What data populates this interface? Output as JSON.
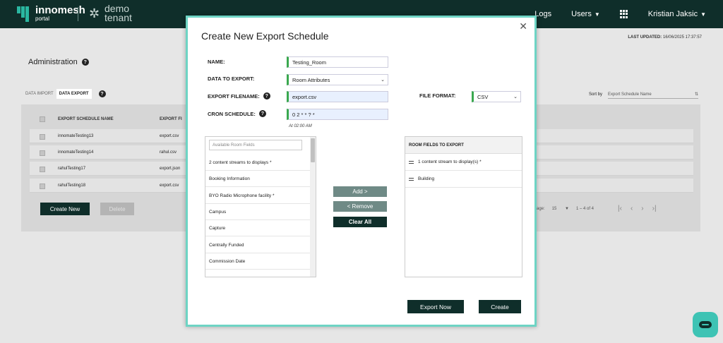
{
  "brand": {
    "name": "innomesh",
    "sub": "portal",
    "tenant_line1": "demo",
    "tenant_line2": "tenant"
  },
  "nav": {
    "items": [
      {
        "label": "Logs",
        "has_caret": false
      },
      {
        "label": "Users",
        "has_caret": true
      }
    ],
    "user": "Kristian Jaksic"
  },
  "background": {
    "last_updated_label": "LAST UPDATED:",
    "last_updated_value": "16/06/2025 17:37:57",
    "page_title": "Administration",
    "tabs": [
      "DATA IMPORT",
      "DATA EXPORT"
    ],
    "active_tab": "DATA EXPORT",
    "sort_by_label": "Sort by",
    "sort_by_value": "Export Schedule Name",
    "table_headers": [
      "EXPORT SCHEDULE NAME",
      "EXPORT FI"
    ],
    "rows": [
      {
        "name": "innomateTesting13",
        "file": "export.csv"
      },
      {
        "name": "innomateTesting14",
        "file": "rahul.csv"
      },
      {
        "name": "rahulTesting17",
        "file": "export.json"
      },
      {
        "name": "rahulTesting18",
        "file": "export.csv"
      }
    ],
    "create_label": "Create New",
    "delete_label": "Delete",
    "per_page_label": "age:",
    "per_page_value": "15",
    "range": "1 – 4 of 4"
  },
  "modal": {
    "title": "Create New Export Schedule",
    "name_label": "NAME:",
    "name_value": "Testing_Room",
    "data_label": "DATA TO EXPORT:",
    "data_value": "Room Attributes",
    "filename_label": "EXPORT FILENAME:",
    "filename_value": "export.csv",
    "format_label": "FILE FORMAT:",
    "format_value": "CSV",
    "cron_label": "CRON SCHEDULE:",
    "cron_value": "0 2 * * ? *",
    "cron_hint": "At 02:00 AM",
    "available_placeholder": "Available Room Fields",
    "available_fields": [
      "2 content streams to displays *",
      "Booking Information",
      "BYO Radio Microphone facility *",
      "Campus",
      "Capture",
      "Centrally Funded",
      "Commission Date"
    ],
    "export_header": "ROOM FIELDS TO EXPORT",
    "export_fields": [
      "1 content stream to display(s) *",
      "Building"
    ],
    "add_label": "Add >",
    "remove_label": "< Remove",
    "clear_label": "Clear All",
    "export_now_label": "Export Now",
    "create_label": "Create"
  }
}
